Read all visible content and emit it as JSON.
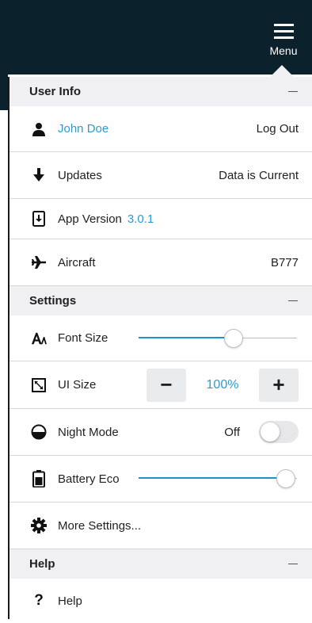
{
  "header": {
    "menu_label": "Menu"
  },
  "sections": {
    "user_info": {
      "title": "User Info",
      "user": {
        "name": "John Doe",
        "action": "Log Out"
      },
      "updates": {
        "label": "Updates",
        "status": "Data is Current"
      },
      "app_version": {
        "label": "App Version",
        "value": "3.0.1"
      },
      "aircraft": {
        "label": "Aircraft",
        "value": "B777"
      }
    },
    "settings": {
      "title": "Settings",
      "font_size": {
        "label": "Font Size",
        "level": 0.6
      },
      "ui_size": {
        "label": "UI Size",
        "value": "100%",
        "minus": "−",
        "plus": "+"
      },
      "night_mode": {
        "label": "Night Mode",
        "state": "Off",
        "on": false
      },
      "battery_eco": {
        "label": "Battery Eco",
        "level": 0.93
      },
      "more": {
        "label": "More Settings..."
      }
    },
    "help": {
      "title": "Help",
      "help_item": {
        "label": "Help",
        "icon_glyph": "?"
      }
    }
  },
  "colors": {
    "accent": "#2c9ccf",
    "header_bg": "#0b212b",
    "section_bg": "#f0f0f2"
  }
}
